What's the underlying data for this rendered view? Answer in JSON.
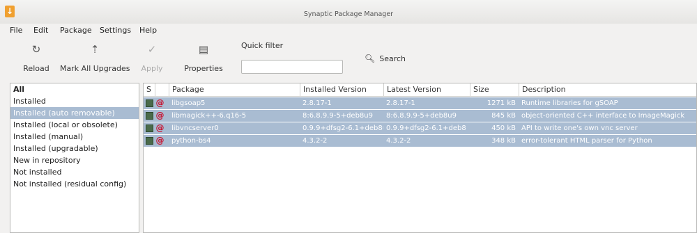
{
  "window": {
    "title": "Synaptic Package Manager",
    "app_icon": "download-arrow-icon"
  },
  "menubar": [
    "File",
    "Edit",
    "Package",
    "Settings",
    "Help"
  ],
  "toolbar": {
    "reload": {
      "label": "Reload",
      "icon": "reload-icon"
    },
    "mark_all_upgrades": {
      "label": "Mark All Upgrades",
      "icon": "mark-upgrades-icon"
    },
    "apply": {
      "label": "Apply",
      "icon": "check-icon",
      "enabled": false
    },
    "properties": {
      "label": "Properties",
      "icon": "properties-icon"
    },
    "quick_filter_label": "Quick filter",
    "quick_filter_value": "",
    "search": {
      "label": "Search",
      "icon": "search-icon"
    }
  },
  "filters": [
    {
      "label": "All",
      "selected": false,
      "bold": true
    },
    {
      "label": "Installed",
      "selected": false
    },
    {
      "label": "Installed (auto removable)",
      "selected": true
    },
    {
      "label": "Installed (local or obsolete)",
      "selected": false
    },
    {
      "label": "Installed (manual)",
      "selected": false
    },
    {
      "label": "Installed (upgradable)",
      "selected": false
    },
    {
      "label": "New in repository",
      "selected": false
    },
    {
      "label": "Not installed",
      "selected": false
    },
    {
      "label": "Not installed (residual config)",
      "selected": false
    }
  ],
  "table": {
    "columns": [
      "S",
      "Package",
      "Installed Version",
      "Latest Version",
      "Size",
      "Description"
    ],
    "rows": [
      {
        "package": "libgsoap5",
        "installed": "2.8.17-1",
        "latest": "2.8.17-1",
        "size": "1271 kB",
        "description": "Runtime libraries for gSOAP"
      },
      {
        "package": "libmagick++-6.q16-5",
        "installed": "8:6.8.9.9-5+deb8u9",
        "latest": "8:6.8.9.9-5+deb8u9",
        "size": "845 kB",
        "description": "object-oriented C++ interface to ImageMagick"
      },
      {
        "package": "libvncserver0",
        "installed": "0.9.9+dfsg2-6.1+deb8u",
        "latest": "0.9.9+dfsg2-6.1+deb8",
        "size": "450 kB",
        "description": "API to write one's own vnc server"
      },
      {
        "package": "python-bs4",
        "installed": "4.3.2-2",
        "latest": "4.3.2-2",
        "size": "348 kB",
        "description": "error-tolerant HTML parser for Python"
      }
    ]
  },
  "colors": {
    "selection": "#a9bcd2",
    "status_box": "#4a6a4a",
    "debian_swirl": "#c8102e"
  }
}
